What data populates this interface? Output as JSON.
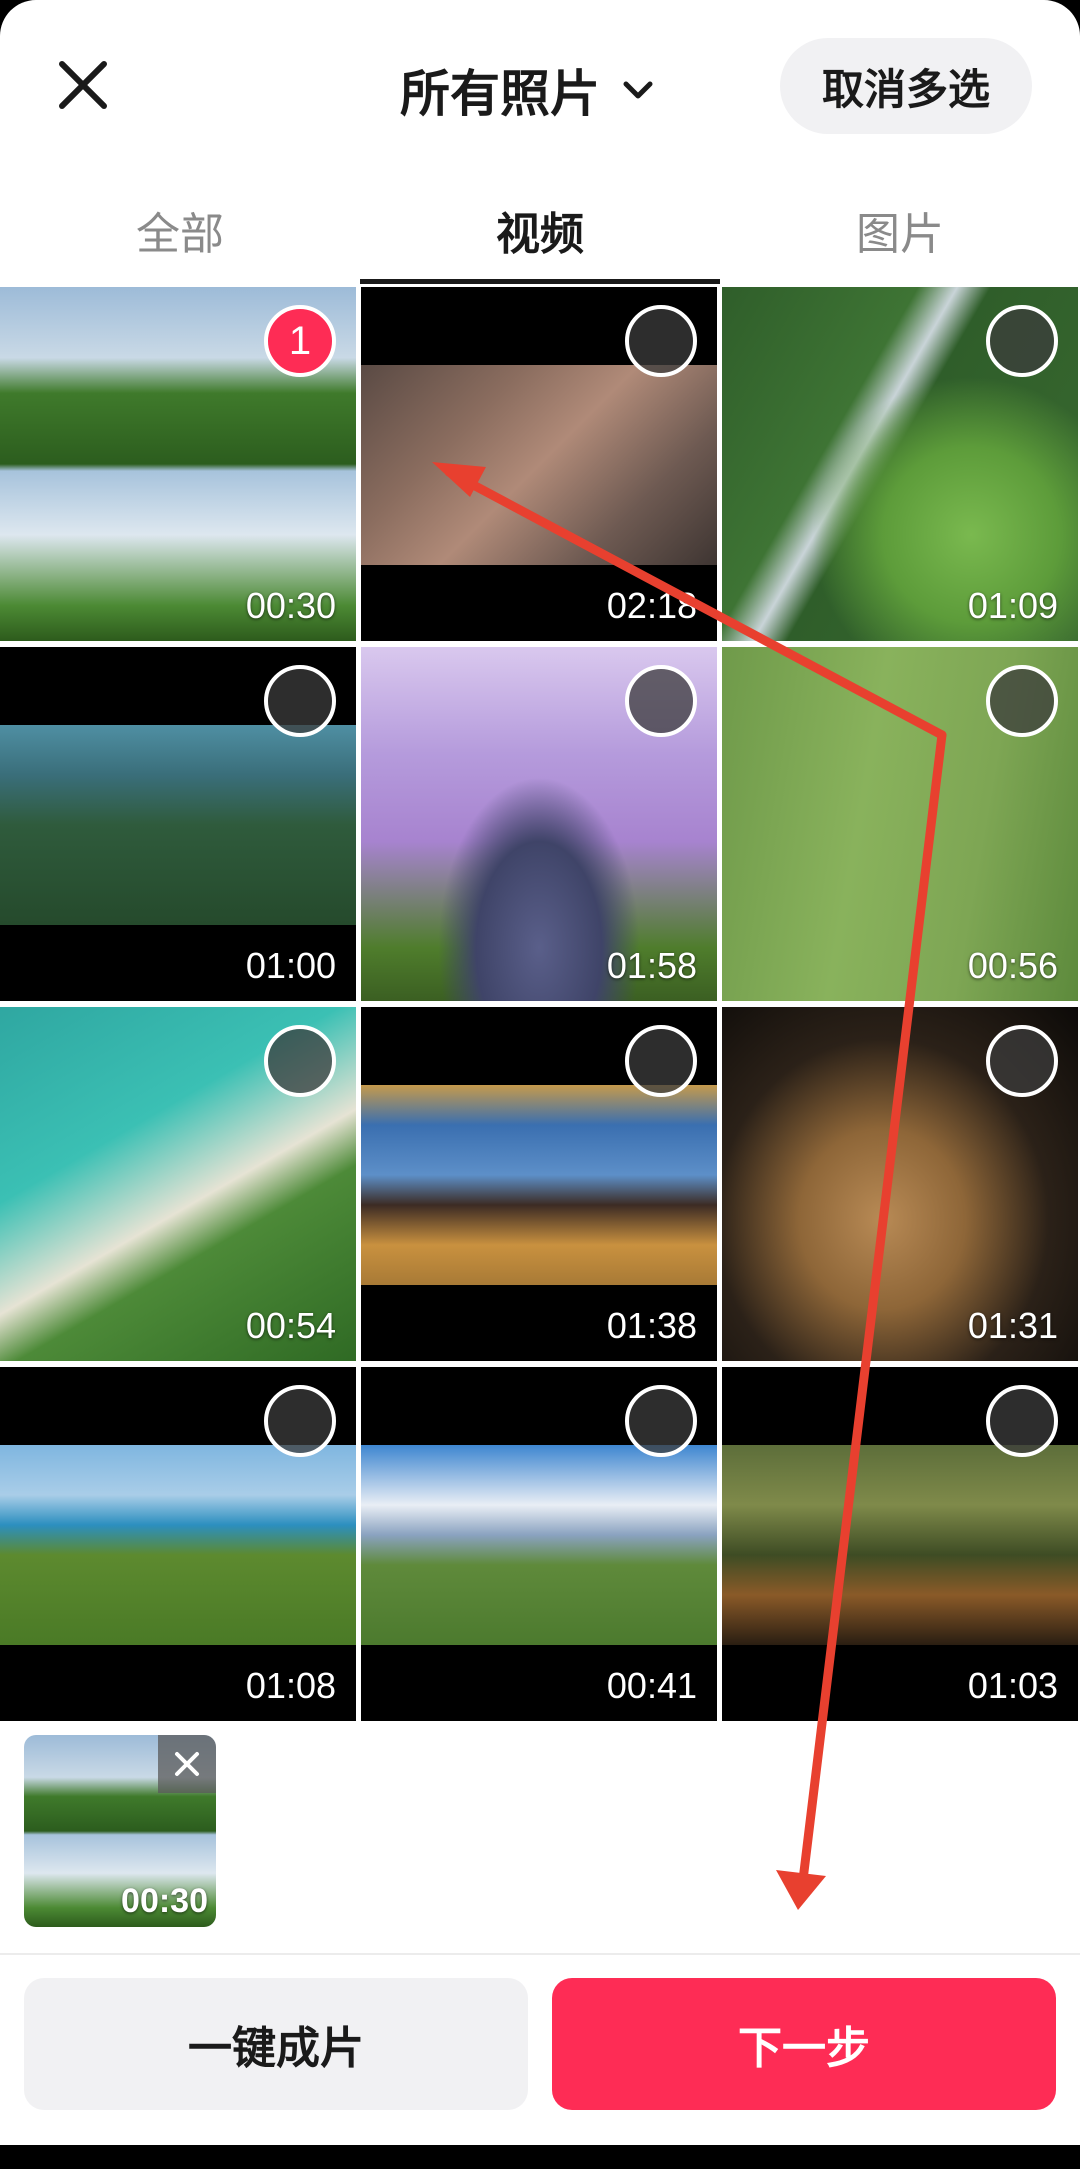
{
  "header": {
    "title": "所有照片",
    "cancel_multi_label": "取消多选"
  },
  "tabs": [
    {
      "label": "全部",
      "active": false
    },
    {
      "label": "视频",
      "active": true
    },
    {
      "label": "图片",
      "active": false
    }
  ],
  "grid": {
    "items": [
      {
        "duration": "00:30",
        "selected": true,
        "selection_index": "1"
      },
      {
        "duration": "02:18",
        "selected": false,
        "selection_index": ""
      },
      {
        "duration": "01:09",
        "selected": false,
        "selection_index": ""
      },
      {
        "duration": "01:00",
        "selected": false,
        "selection_index": ""
      },
      {
        "duration": "01:58",
        "selected": false,
        "selection_index": ""
      },
      {
        "duration": "00:56",
        "selected": false,
        "selection_index": ""
      },
      {
        "duration": "00:54",
        "selected": false,
        "selection_index": ""
      },
      {
        "duration": "01:38",
        "selected": false,
        "selection_index": ""
      },
      {
        "duration": "01:31",
        "selected": false,
        "selection_index": ""
      },
      {
        "duration": "01:08",
        "selected": false,
        "selection_index": ""
      },
      {
        "duration": "00:41",
        "selected": false,
        "selection_index": ""
      },
      {
        "duration": "01:03",
        "selected": false,
        "selection_index": ""
      }
    ]
  },
  "selected_strip": {
    "duration": "00:30"
  },
  "footer": {
    "one_key_label": "一键成片",
    "next_label": "下一步"
  },
  "colors": {
    "accent": "#fe2c55",
    "annotation": "#e8402f"
  }
}
